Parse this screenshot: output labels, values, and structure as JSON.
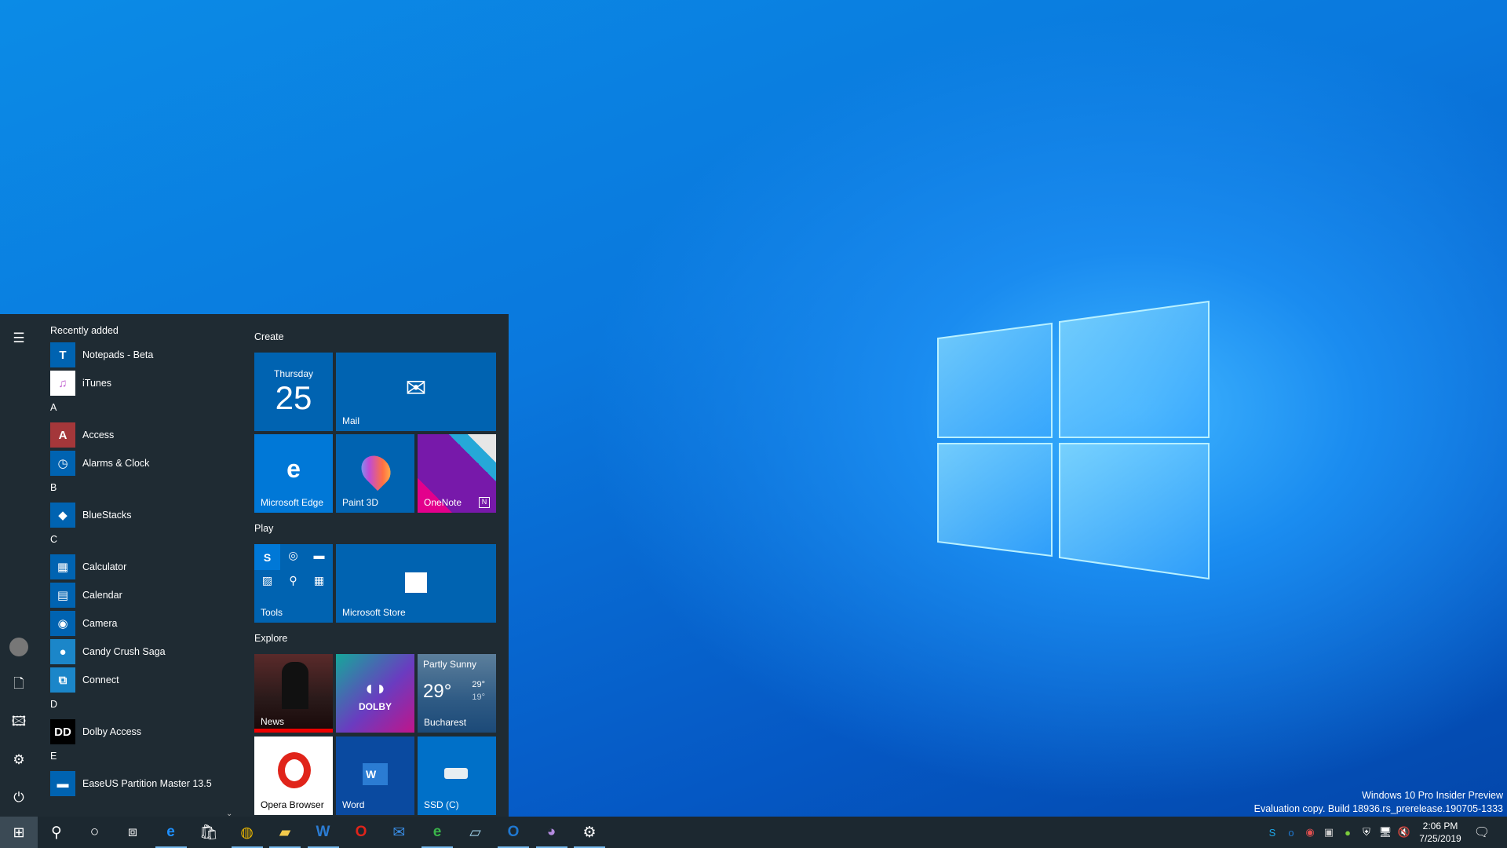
{
  "desktop": {
    "watermark_line1": "Windows 10 Pro Insider Preview",
    "watermark_line2": "Evaluation copy. Build 18936.rs_prerelease.190705-1333"
  },
  "start_menu": {
    "recently_added": "Recently added",
    "apps": [
      {
        "type": "header",
        "label": "Recently added"
      },
      {
        "label": "Notepads - Beta",
        "color": "#0063b1",
        "icon": "T"
      },
      {
        "label": "iTunes",
        "color": "#ffffff",
        "icon": "♫"
      },
      {
        "type": "letter",
        "label": "A"
      },
      {
        "label": "Access",
        "color": "#a4373a",
        "icon": "A"
      },
      {
        "label": "Alarms & Clock",
        "color": "#0063b1",
        "icon": "◷"
      },
      {
        "type": "letter",
        "label": "B"
      },
      {
        "label": "BlueStacks",
        "color": "#0063b1",
        "icon": "◆"
      },
      {
        "type": "letter",
        "label": "C"
      },
      {
        "label": "Calculator",
        "color": "#0063b1",
        "icon": "▦"
      },
      {
        "label": "Calendar",
        "color": "#0063b1",
        "icon": "▤"
      },
      {
        "label": "Camera",
        "color": "#0063b1",
        "icon": "◉"
      },
      {
        "label": "Candy Crush Saga",
        "color": "#1b86c9",
        "icon": "●"
      },
      {
        "label": "Connect",
        "color": "#1b86c9",
        "icon": "⧉"
      },
      {
        "type": "letter",
        "label": "D"
      },
      {
        "label": "Dolby Access",
        "color": "#000000",
        "icon": "DD"
      },
      {
        "type": "letter",
        "label": "E"
      },
      {
        "label": "EaseUS Partition Master 13.5",
        "color": "#0063b1",
        "icon": "▬"
      }
    ],
    "groups": {
      "create": "Create",
      "play": "Play",
      "explore": "Explore"
    },
    "tiles": {
      "calendar_day": "Thursday",
      "calendar_date": "25",
      "mail": "Mail",
      "edge": "Microsoft Edge",
      "paint3d": "Paint 3D",
      "onenote": "OneNote",
      "tools": "Tools",
      "store": "Microsoft Store",
      "news": "News",
      "dolby": "DOLBY",
      "weather_condition": "Partly Sunny",
      "weather_temp": "29°",
      "weather_high": "29°",
      "weather_low": "19°",
      "weather_city": "Bucharest",
      "opera": "Opera Browser",
      "word": "Word",
      "ssd": "SSD (C)"
    }
  },
  "taskbar": {
    "time": "2:06 PM",
    "date": "7/25/2019",
    "apps": [
      {
        "name": "search",
        "glyph": "⚲",
        "running": false
      },
      {
        "name": "cortana",
        "glyph": "○",
        "running": false
      },
      {
        "name": "task-view",
        "glyph": "⧈",
        "running": false
      },
      {
        "name": "edge",
        "glyph": "e",
        "running": true,
        "color": "#1e90ff"
      },
      {
        "name": "store",
        "glyph": "🛍",
        "running": false
      },
      {
        "name": "chrome",
        "glyph": "◍",
        "running": true,
        "color": "#e8b500"
      },
      {
        "name": "file-explorer",
        "glyph": "▰",
        "running": true,
        "color": "#f2c94c"
      },
      {
        "name": "word",
        "glyph": "W",
        "running": true,
        "color": "#2b7cd3"
      },
      {
        "name": "opera",
        "glyph": "O",
        "running": false,
        "color": "#e0241a"
      },
      {
        "name": "mail",
        "glyph": "✉",
        "running": false,
        "color": "#3a8ee6"
      },
      {
        "name": "edge-dev",
        "glyph": "e",
        "running": true,
        "color": "#3ab54a"
      },
      {
        "name": "notepad",
        "glyph": "▱",
        "running": false,
        "color": "#9fd0e8"
      },
      {
        "name": "outlook",
        "glyph": "O",
        "running": true,
        "color": "#1f78d1"
      },
      {
        "name": "chat",
        "glyph": "◕",
        "running": true,
        "color": "#b48be0"
      },
      {
        "name": "settings",
        "glyph": "⚙",
        "running": true
      }
    ],
    "tray": [
      {
        "name": "skype",
        "glyph": "S",
        "color": "#1ea7e8"
      },
      {
        "name": "outlook",
        "glyph": "o",
        "color": "#1f78d1"
      },
      {
        "name": "eye",
        "glyph": "◉",
        "color": "#e05050"
      },
      {
        "name": "camera",
        "glyph": "▣",
        "color": "#cccccc"
      },
      {
        "name": "chat",
        "glyph": "●",
        "color": "#7ccc3c"
      },
      {
        "name": "defender",
        "glyph": "⛨",
        "color": "#ffffff"
      },
      {
        "name": "network",
        "glyph": "🖥",
        "color": "#ffffff"
      },
      {
        "name": "volume-muted",
        "glyph": "🔇",
        "color": "#ffffff"
      }
    ]
  }
}
